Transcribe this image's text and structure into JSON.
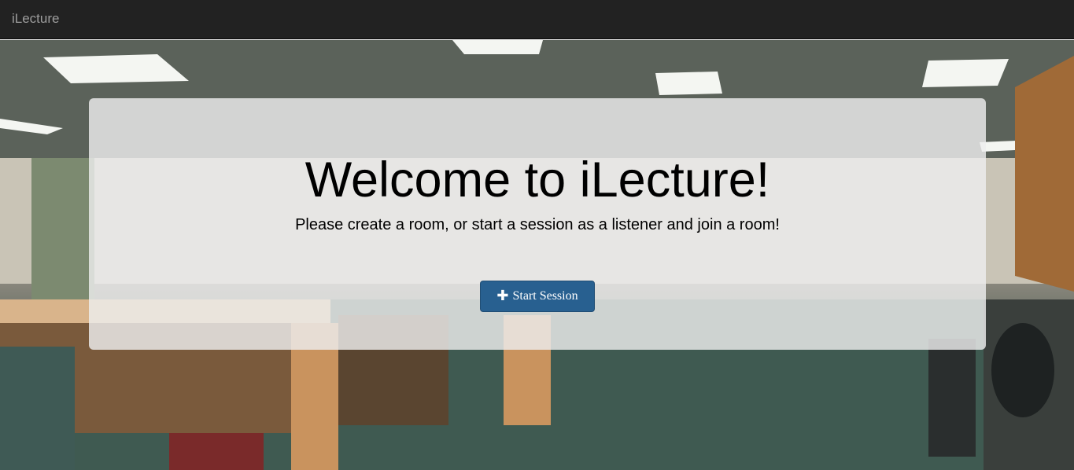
{
  "navbar": {
    "brand": "iLecture"
  },
  "hero": {
    "title": "Welcome to iLecture!",
    "subtitle": "Please create a room, or start a session as a listener and join a room!",
    "start_button": {
      "icon": "plus-icon",
      "glyph": "✚",
      "label": "Start Session"
    }
  },
  "colors": {
    "navbar_bg": "#222222",
    "brand_text": "#9d9d9d",
    "button_bg": "#286090"
  }
}
